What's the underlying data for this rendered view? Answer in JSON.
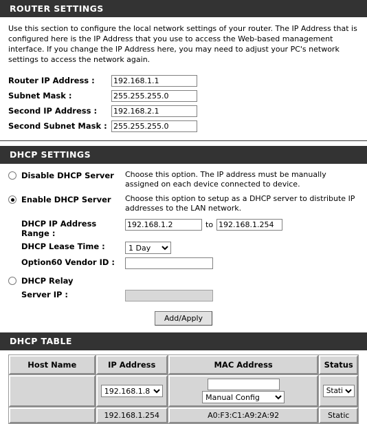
{
  "router_settings": {
    "section_title": "ROUTER SETTINGS",
    "description": "Use this section to configure the local network settings of your router. The IP Address that is configured here is the IP Address that you use to access the Web-based management interface. If you change the IP Address here, you may need to adjust your PC's network settings to access the network again.",
    "fields": [
      {
        "label": "Router IP Address :",
        "value": "192.168.1.1"
      },
      {
        "label": "Subnet Mask :",
        "value": "255.255.255.0"
      },
      {
        "label": "Second IP Address :",
        "value": "192.168.2.1"
      },
      {
        "label": "Second Subnet Mask :",
        "value": "255.255.255.0"
      }
    ]
  },
  "dhcp_settings": {
    "section_title": "DHCP SETTINGS",
    "disable_option": {
      "label": "Disable DHCP Server",
      "description": "Choose this option. The IP address must be manually assigned on each device connected to device.",
      "selected": false
    },
    "enable_option": {
      "label": "Enable DHCP Server",
      "description": "Choose this option to setup as a DHCP server to distribute IP addresses to the LAN network.",
      "selected": true
    },
    "ip_range": {
      "label": "DHCP IP Address Range :",
      "start": "192.168.1.2",
      "to_word": "to",
      "end": "192.168.1.254"
    },
    "lease_time": {
      "label": "DHCP Lease Time :",
      "value": "1 Day",
      "options": [
        "1 Day"
      ]
    },
    "vendor_id": {
      "label": "Option60 Vendor ID :",
      "value": ""
    },
    "relay_option": {
      "label": "DHCP Relay",
      "selected": false
    },
    "server_ip": {
      "label": "Server IP :",
      "value": "",
      "disabled": true
    }
  },
  "apply": {
    "button_label": "Add/Apply"
  },
  "dhcp_table": {
    "section_title": "DHCP TABLE",
    "columns": [
      "Host Name",
      "IP Address",
      "MAC Address",
      "Status"
    ],
    "edit_row": {
      "host_name": "",
      "ip_address": {
        "value": "192.168.1.8",
        "options": [
          "192.168.1.8"
        ]
      },
      "mac_address_input": "",
      "mac_mode": {
        "value": "Manual Config",
        "options": [
          "Manual Config"
        ]
      },
      "status": {
        "value": "Static",
        "options": [
          "Static"
        ]
      }
    },
    "rows": [
      {
        "host_name": "",
        "ip_address": "192.168.1.254",
        "mac_address": "A0:F3:C1:A9:2A:92",
        "status": "Static"
      }
    ]
  },
  "colors": {
    "section_bar_bg": "#333333",
    "section_bar_text": "#ffffff",
    "table_cell_bg": "#d6d6d6",
    "disabled_field_bg": "#d8d8d8",
    "button_bg": "#e2e2e2"
  }
}
